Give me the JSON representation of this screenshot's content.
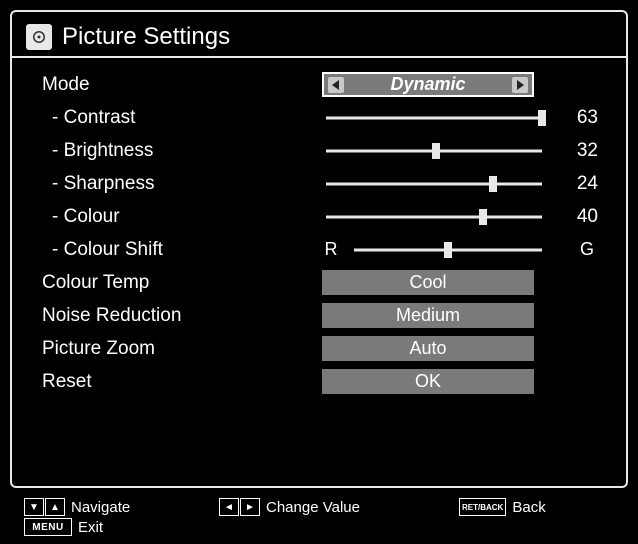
{
  "title": "Picture Settings",
  "rows": {
    "mode": {
      "label": "Mode",
      "value": "Dynamic"
    },
    "contrast": {
      "label": "- Contrast",
      "value": 63,
      "max": 63
    },
    "brightness": {
      "label": "- Brightness",
      "value": 32,
      "max": 63
    },
    "sharpness": {
      "label": "- Sharpness",
      "value": 24,
      "max": 31
    },
    "colour": {
      "label": "- Colour",
      "value": 40,
      "max": 55
    },
    "colourShift": {
      "label": "- Colour Shift",
      "left": "R",
      "right": "G",
      "value": 0,
      "min": -30,
      "max": 30
    },
    "colourTemp": {
      "label": "Colour Temp",
      "value": "Cool"
    },
    "noise": {
      "label": "Noise Reduction",
      "value": "Medium"
    },
    "zoom": {
      "label": "Picture Zoom",
      "value": "Auto"
    },
    "reset": {
      "label": "Reset",
      "value": "OK"
    }
  },
  "footer": {
    "navigate": "Navigate",
    "change": "Change Value",
    "back": "Back",
    "exit": "Exit",
    "menuKey": "MENU",
    "retKey": "RET/BACK"
  }
}
